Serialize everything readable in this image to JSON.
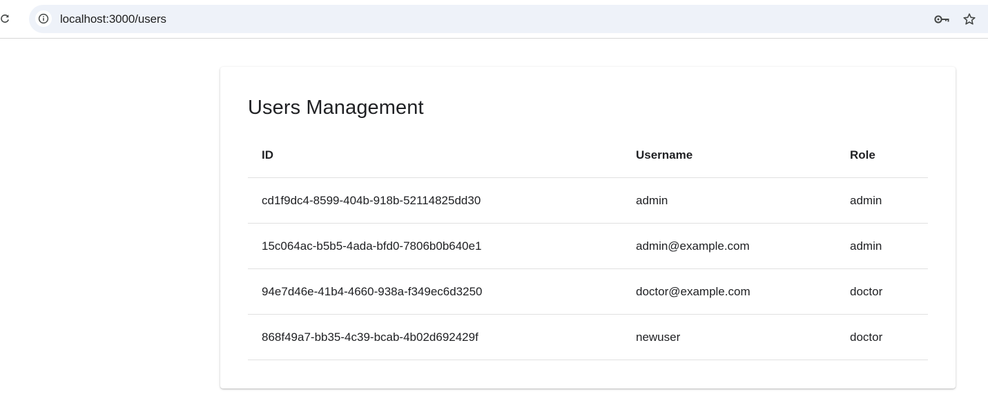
{
  "browser": {
    "url": "localhost:3000/users",
    "icons": {
      "reload": "reload-icon",
      "site_info": "info-icon",
      "password": "key-icon",
      "bookmark": "star-icon"
    }
  },
  "page": {
    "title": "Users Management"
  },
  "table": {
    "columns": [
      "ID",
      "Username",
      "Role"
    ],
    "rows": [
      {
        "id": "cd1f9dc4-8599-404b-918b-52114825dd30",
        "username": "admin",
        "role": "admin"
      },
      {
        "id": "15c064ac-b5b5-4ada-bfd0-7806b0b640e1",
        "username": "admin@example.com",
        "role": "admin"
      },
      {
        "id": "94e7d46e-41b4-4660-938a-f349ec6d3250",
        "username": "doctor@example.com",
        "role": "doctor"
      },
      {
        "id": "868f49a7-bb35-4c39-bcab-4b02d692429f",
        "username": "newuser",
        "role": "doctor"
      }
    ]
  },
  "colors": {
    "omnibox_bg": "#eef2f9",
    "divider": "#e0e0e0",
    "text": "#202124"
  }
}
